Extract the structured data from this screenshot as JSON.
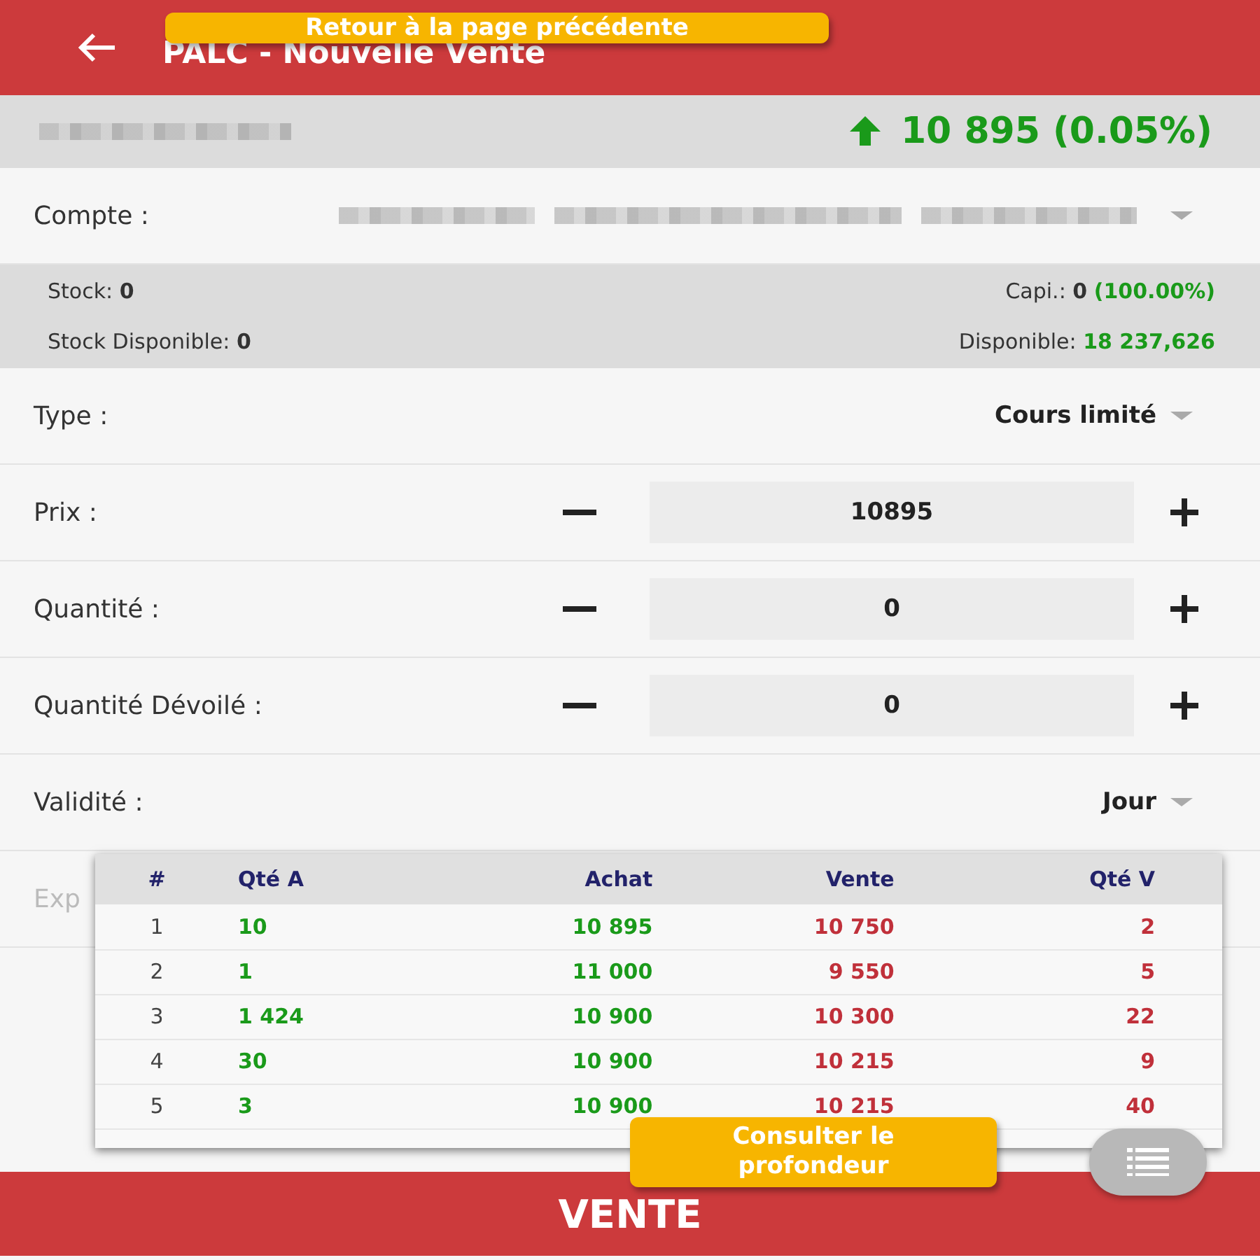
{
  "header": {
    "title": "PALC - Nouvelle Vente",
    "back_tooltip": "Retour à la page précédente"
  },
  "quote": {
    "rising": true,
    "price": "10 895 (0.05%)"
  },
  "account": {
    "label": "Compte :"
  },
  "summary": [
    {
      "label": "Stock:",
      "value": "0",
      "positive": false
    },
    {
      "label": "Capi.:",
      "value": "0",
      "extra": "(100.00%)",
      "positive": false
    },
    {
      "label": "Stock Disponible:",
      "value": "0",
      "positive": false
    },
    {
      "label": "Disponible:",
      "value": "18 237,626",
      "positive": true
    }
  ],
  "fields": [
    {
      "kind": "select",
      "label": "Type :",
      "value": "Cours limité"
    },
    {
      "kind": "stepper",
      "label": "Prix :",
      "value": "10895"
    },
    {
      "kind": "stepper",
      "label": "Quantité :",
      "value": "0"
    },
    {
      "kind": "stepper",
      "label": "Quantité Dévoilé :",
      "value": "0"
    },
    {
      "kind": "select",
      "label": "Validité :",
      "value": "Jour"
    },
    {
      "kind": "hidden",
      "label": "Exp"
    }
  ],
  "depth": {
    "columns": [
      "#",
      "Qté A",
      "Achat",
      "Vente",
      "Qté V"
    ],
    "rows": [
      [
        "1",
        "10",
        "10 895",
        "10 750",
        "2"
      ],
      [
        "2",
        "1",
        "11 000",
        "9 550",
        "5"
      ],
      [
        "3",
        "1 424",
        "10 900",
        "10 300",
        "22"
      ],
      [
        "4",
        "30",
        "10 900",
        "10 215",
        "9"
      ],
      [
        "5",
        "3",
        "10 900",
        "10 215",
        "40"
      ]
    ],
    "tooltip": "Consulter le profondeur"
  },
  "submit": "VENTE"
}
